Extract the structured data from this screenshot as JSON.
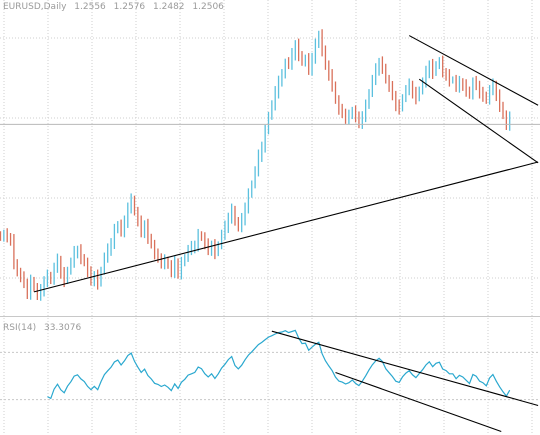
{
  "price_header": {
    "symbol": "EURUSD,Daily",
    "open": "1.2556",
    "high": "1.2576",
    "low": "1.2482",
    "close": "1.2506"
  },
  "rsi_header": {
    "label": "RSI(14)",
    "value": "33.3076"
  },
  "colors": {
    "bull": "#5bc0de",
    "bear": "#d9705a",
    "grid": "#cfcfcf",
    "trendline": "#000000",
    "rsi_line": "#2aa8cf",
    "rsi_level": "#c8c8c8"
  },
  "chart_data": [
    {
      "type": "candlestick",
      "title": "EURUSD,Daily",
      "ylim": [
        1.215,
        1.334
      ],
      "close_series": [
        1.246,
        1.247,
        1.246,
        1.245,
        1.236,
        1.232,
        1.23,
        1.228,
        1.224,
        1.229,
        1.226,
        1.223,
        1.225,
        1.229,
        1.231,
        1.229,
        1.234,
        1.237,
        1.232,
        1.229,
        1.233,
        1.236,
        1.24,
        1.241,
        1.238,
        1.236,
        1.232,
        1.229,
        1.231,
        1.228,
        1.233,
        1.238,
        1.241,
        1.244,
        1.249,
        1.251,
        1.248,
        1.252,
        1.258,
        1.261,
        1.256,
        1.252,
        1.248,
        1.251,
        1.246,
        1.243,
        1.239,
        1.238,
        1.236,
        1.237,
        1.235,
        1.232,
        1.236,
        1.232,
        1.236,
        1.238,
        1.241,
        1.242,
        1.243,
        1.247,
        1.246,
        1.243,
        1.241,
        1.243,
        1.24,
        1.243,
        1.247,
        1.25,
        1.254,
        1.257,
        1.252,
        1.25,
        1.253,
        1.258,
        1.263,
        1.267,
        1.272,
        1.278,
        1.282,
        1.288,
        1.294,
        1.298,
        1.303,
        1.308,
        1.31,
        1.315,
        1.314,
        1.318,
        1.322,
        1.318,
        1.315,
        1.316,
        1.312,
        1.317,
        1.322,
        1.326,
        1.319,
        1.314,
        1.31,
        1.306,
        1.3,
        1.296,
        1.295,
        1.293,
        1.294,
        1.296,
        1.293,
        1.291,
        1.294,
        1.298,
        1.303,
        1.308,
        1.312,
        1.315,
        1.313,
        1.308,
        1.305,
        1.302,
        1.298,
        1.297,
        1.301,
        1.304,
        1.306,
        1.303,
        1.301,
        1.304,
        1.307,
        1.311,
        1.314,
        1.311,
        1.314,
        1.315,
        1.311,
        1.31,
        1.308,
        1.308,
        1.305,
        1.307,
        1.306,
        1.304,
        1.302,
        1.307,
        1.306,
        1.303,
        1.302,
        1.3,
        1.304,
        1.306,
        1.302,
        1.298,
        1.294,
        1.29,
        1.293
      ],
      "trendlines": [
        {
          "from": [
            10,
            1.2245
          ],
          "to": [
            156,
            1.2745
          ]
        },
        {
          "from": [
            122,
            1.3255
          ],
          "to": [
            156,
            1.3012
          ]
        },
        {
          "from": [
            125,
            1.3083
          ],
          "to": [
            156,
            1.2785
          ]
        }
      ],
      "horizontal_line": 1.2905
    },
    {
      "type": "line",
      "title": "RSI(14)",
      "ylim": [
        0,
        100
      ],
      "levels": [
        30,
        70
      ],
      "trendlines": [
        {
          "from": [
            81,
            88
          ],
          "to": [
            156,
            25
          ]
        },
        {
          "from": [
            100,
            53
          ],
          "to": [
            145,
            3
          ]
        }
      ]
    }
  ]
}
